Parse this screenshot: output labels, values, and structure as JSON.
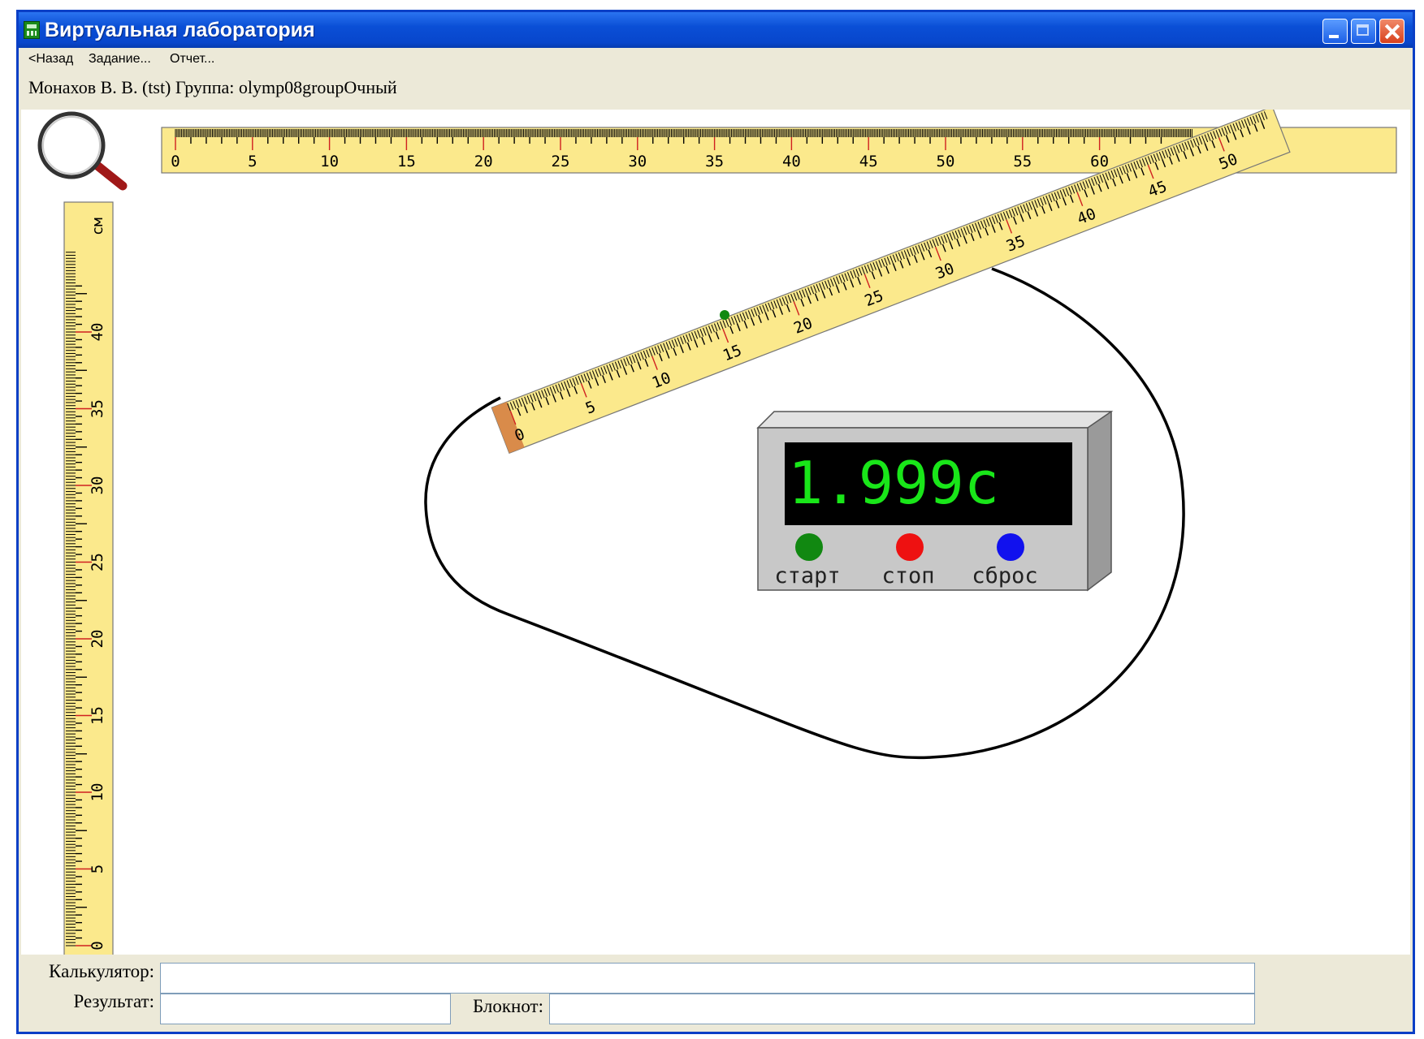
{
  "window": {
    "title": "Виртуальная лаборатория",
    "controls": [
      "minimize",
      "maximize",
      "close"
    ],
    "title_bar_color": "#0a4fd6"
  },
  "menu": {
    "items": [
      "<Назад",
      "Задание...",
      "Отчет..."
    ]
  },
  "user_line": "Монахов В. В. (tst)  Группа: olymp08groupОчный",
  "lab": {
    "ruler_color": "#fbe98c",
    "tick_red_color": "#d02020",
    "horizontal_ruler": {
      "labels": [
        "0",
        "5",
        "10",
        "15",
        "20",
        "25",
        "30",
        "35",
        "40",
        "45",
        "50",
        "55",
        "60"
      ]
    },
    "vertical_ruler": {
      "labels": [
        "0",
        "5",
        "10",
        "15",
        "20",
        "25",
        "30",
        "35",
        "40"
      ],
      "unit": "см"
    },
    "tilted_ruler": {
      "labels": [
        "0",
        "5",
        "10",
        "15",
        "20",
        "25",
        "30",
        "35",
        "40",
        "45",
        "50"
      ]
    },
    "magnifier_icon": "magnifier-icon",
    "stopwatch": {
      "reading": "1.999с",
      "display_color": "#19e619",
      "buttons": [
        {
          "label": "старт",
          "color": "#118811"
        },
        {
          "label": "стоп",
          "color": "#ee1111"
        },
        {
          "label": "сброс",
          "color": "#1111ee"
        }
      ]
    }
  },
  "bottom": {
    "calculator_label": "Калькулятор:",
    "calculator_value": "",
    "result_label": "Результат:",
    "result_value": "",
    "notepad_label": "Блокнот:",
    "notepad_value": ""
  }
}
